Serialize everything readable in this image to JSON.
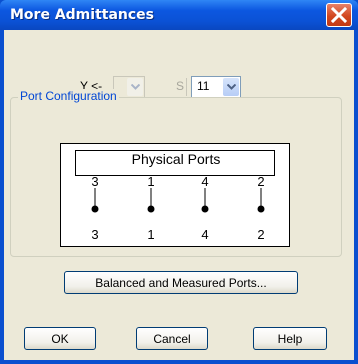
{
  "window": {
    "title": "More Admittances"
  },
  "y_row": {
    "label": "Y <-",
    "s_label": "S",
    "first_selector_value": "",
    "port_selector_value": "11"
  },
  "port_configuration": {
    "label": "Port Configuration",
    "physical_ports_title": "Physical Ports",
    "top_ports": [
      "3",
      "1",
      "4",
      "2"
    ],
    "bottom_ports": [
      "3",
      "1",
      "4",
      "2"
    ]
  },
  "buttons": {
    "balanced_measured": "Balanced and Measured Ports...",
    "ok": "OK",
    "cancel": "Cancel",
    "help": "Help"
  },
  "colors": {
    "titlebar": "#0b52d6",
    "dialog_bg": "#ece9d8",
    "group_title": "#0046d5",
    "close_button": "#d2471f"
  }
}
